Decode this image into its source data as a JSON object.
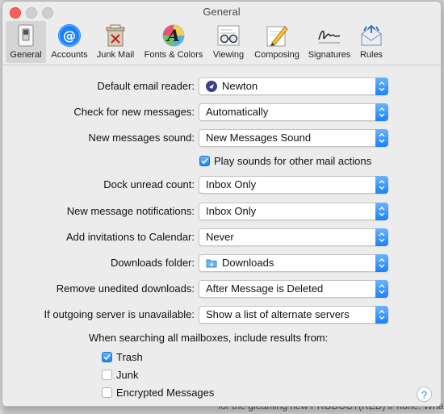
{
  "background": {
    "text": "for the gleaming new PRODUCT(RED) iPhone. What abo"
  },
  "window": {
    "title": "General"
  },
  "toolbar": {
    "tabs": [
      {
        "label": "General",
        "icon": "switch-icon",
        "active": true
      },
      {
        "label": "Accounts",
        "icon": "at-icon",
        "active": false
      },
      {
        "label": "Junk Mail",
        "icon": "trash-bin-icon",
        "active": false
      },
      {
        "label": "Fonts & Colors",
        "icon": "fonts-icon",
        "active": false
      },
      {
        "label": "Viewing",
        "icon": "glasses-icon",
        "active": false
      },
      {
        "label": "Composing",
        "icon": "pencil-icon",
        "active": false
      },
      {
        "label": "Signatures",
        "icon": "signature-icon",
        "active": false
      },
      {
        "label": "Rules",
        "icon": "rules-icon",
        "active": false
      }
    ]
  },
  "settings": {
    "default_reader": {
      "label": "Default email reader:",
      "value": "Newton",
      "icon": "newton-app-icon"
    },
    "check_messages": {
      "label": "Check for new messages:",
      "value": "Automatically"
    },
    "new_sound": {
      "label": "New messages sound:",
      "value": "New Messages Sound"
    },
    "play_sounds": {
      "label": "Play sounds for other mail actions",
      "checked": true
    },
    "dock_count": {
      "label": "Dock unread count:",
      "value": "Inbox Only"
    },
    "notifications": {
      "label": "New message notifications:",
      "value": "Inbox Only"
    },
    "invitations": {
      "label": "Add invitations to Calendar:",
      "value": "Never"
    },
    "downloads_folder": {
      "label": "Downloads folder:",
      "value": "Downloads",
      "icon": "folder-icon"
    },
    "remove_downloads": {
      "label": "Remove unedited downloads:",
      "value": "After Message is Deleted"
    },
    "outgoing_server": {
      "label": "If outgoing server is unavailable:",
      "value": "Show a list of alternate servers"
    }
  },
  "search": {
    "heading": "When searching all mailboxes, include results from:",
    "options": [
      {
        "label": "Trash",
        "checked": true
      },
      {
        "label": "Junk",
        "checked": false
      },
      {
        "label": "Encrypted Messages",
        "checked": false
      }
    ]
  },
  "help": {
    "label": "?"
  },
  "colors": {
    "accent": "#1a82fb",
    "close": "#fc605c"
  }
}
